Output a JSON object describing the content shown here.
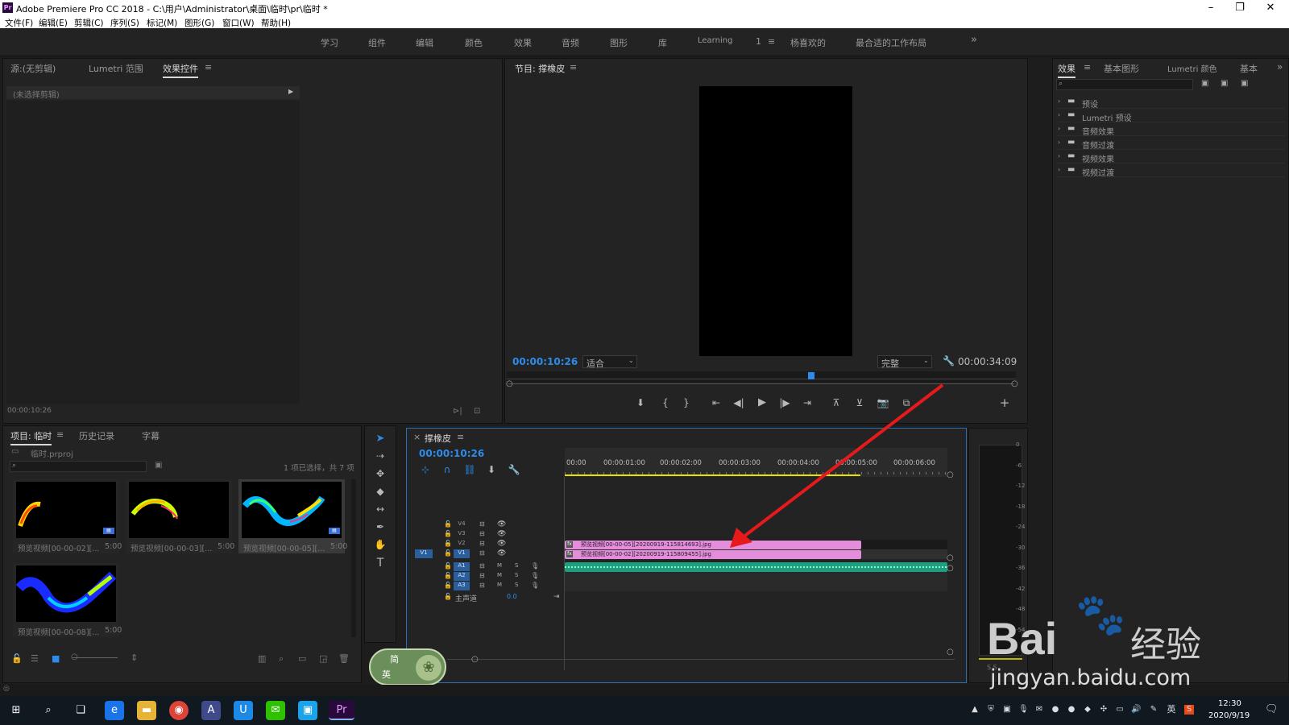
{
  "titlebar": {
    "title": "Adobe Premiere Pro CC 2018 - C:\\用户\\Administrator\\桌面\\临时\\pr\\临时 *",
    "logo": "Pr"
  },
  "menu": [
    "文件(F)",
    "编辑(E)",
    "剪辑(C)",
    "序列(S)",
    "标记(M)",
    "图形(G)",
    "窗口(W)",
    "帮助(H)"
  ],
  "workspaces": [
    "学习",
    "组件",
    "编辑",
    "颜色",
    "效果",
    "音频",
    "图形",
    "库",
    "Learning",
    "1",
    "杨喜欢的",
    "最合适的工作布局"
  ],
  "more_chevron": "»",
  "source_panel": {
    "tabs": [
      "源:(无剪辑)",
      "Lumetri 范围",
      "效果控件"
    ],
    "no_clip": "(未选择剪辑)",
    "timecode": "00:00:10:26"
  },
  "program_panel": {
    "title": "节目: 撑橡皮",
    "timecode": "00:00:10:26",
    "fit": "适合",
    "quality": "完整",
    "duration": "00:00:34:09"
  },
  "effects_panel": {
    "tabs": [
      "效果",
      "基本图形",
      "Lumetri 颜色",
      "基本"
    ],
    "items": [
      "预设",
      "Lumetri 预设",
      "音频效果",
      "音频过渡",
      "视频效果",
      "视频过渡"
    ]
  },
  "project_panel": {
    "tabs": [
      "项目: 临时",
      "历史记录",
      "字幕"
    ],
    "file": "临时.prproj",
    "selection": "1 项已选择，共 7 项",
    "items": [
      {
        "name": "预览视频[00-00-02][...",
        "dur": "5:00"
      },
      {
        "name": "预览视频[00-00-03][...",
        "dur": "5:00"
      },
      {
        "name": "预览视频[00-00-05][...",
        "dur": "5:00"
      },
      {
        "name": "预览视频[00-00-08][...",
        "dur": "5:00"
      }
    ]
  },
  "timeline": {
    "title": "撑橡皮",
    "timecode": "00:00:10:26",
    "ruler": [
      "00:00",
      "00:00:01:00",
      "00:00:02:00",
      "00:00:03:00",
      "00:00:04:00",
      "00:00:05:00",
      "00:00:06:00"
    ],
    "tracks": [
      "V4",
      "V3",
      "V2",
      "V1",
      "A1",
      "A2",
      "A3"
    ],
    "source_patch": "V1",
    "track_m": "M",
    "track_s": "S",
    "master": "主声道",
    "master_val": "0.0",
    "clip_v2": "预览视频[00-00-05][20200919-115814693].jpg",
    "clip_v1": "预览视频[00-00-02][20200919-115809455].jpg"
  },
  "meter": {
    "ticks": [
      "0",
      "-6",
      "-12",
      "-18",
      "-24",
      "-30",
      "-36",
      "-42",
      "-48",
      "-54"
    ],
    "solo": "S   S"
  },
  "ime": {
    "line1": "简",
    "line2": "英"
  },
  "watermark": {
    "brand": "Bai",
    "brand_cn": "经验",
    "url": "jingyan.baidu.com"
  },
  "taskbar": {
    "time": "12:30",
    "date": "2020/9/19",
    "lang": "英"
  },
  "colors": {
    "accent": "#2d8ceb",
    "clip_video": "#e38ddb",
    "clip_audio": "#1f9e7e",
    "arrow": "#e8191b"
  }
}
